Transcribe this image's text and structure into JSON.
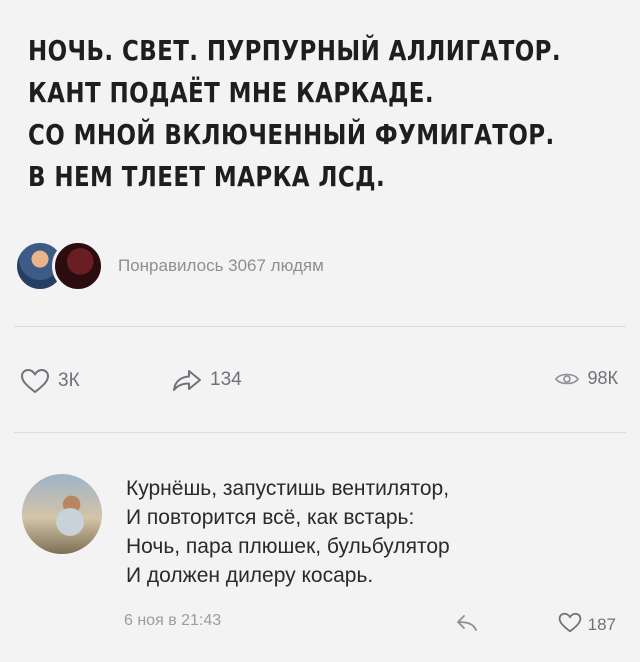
{
  "post": {
    "lines": [
      "НОЧЬ. СВЕТ. ПУРПУРНЫЙ АЛЛИГАТОР.",
      "КАНТ ПОДАЁТ МНЕ КАРКАДЕ.",
      "СО МНОЙ ВКЛЮЧЕННЫЙ ФУМИГАТОР.",
      "В НЕМ ТЛЕЕТ МАРКА ЛСД."
    ],
    "likes_summary": "Понравилось 3067 людям"
  },
  "actions": {
    "likes": "3К",
    "shares": "134",
    "views": "98К"
  },
  "comment": {
    "lines": [
      "Курнёшь, запустишь вентилятор,",
      "И повторится всё, как встарь:",
      "Ночь, пара плюшек, бульбулятор",
      "И должен дилеру косарь."
    ],
    "date": "6 ноя в 21:43",
    "likes": "187"
  },
  "icons": {
    "like": "heart-outline-icon",
    "share": "share-arrow-icon",
    "views": "eye-icon",
    "reply": "reply-arrow-icon",
    "comment_like": "heart-outline-icon"
  },
  "colors": {
    "background": "#f3f3f4",
    "muted_text": "#8d8f94",
    "icon": "#6f7278"
  }
}
